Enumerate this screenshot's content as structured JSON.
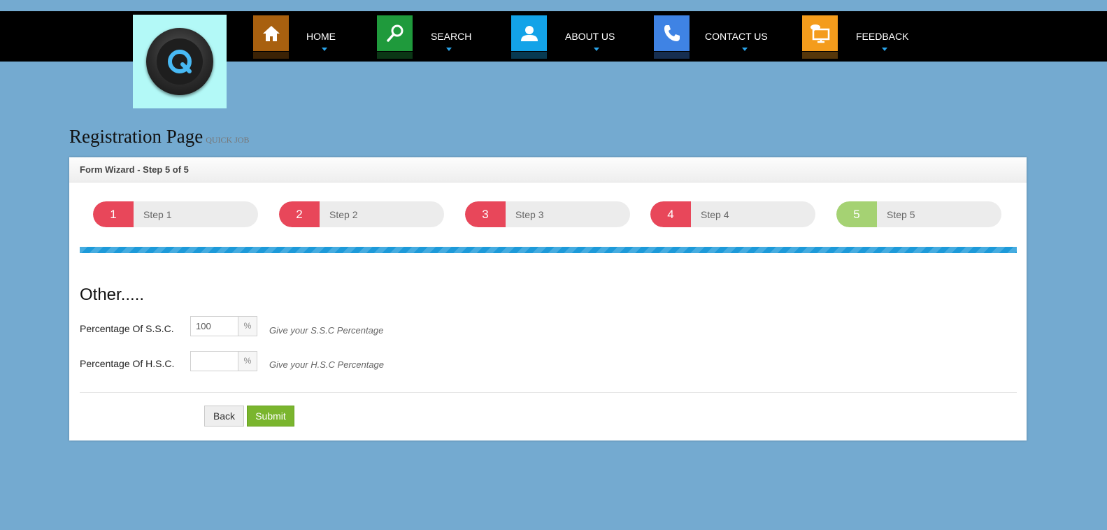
{
  "nav": {
    "items": [
      {
        "label": "HOME",
        "icon": "home-icon",
        "color": "#a8600f"
      },
      {
        "label": "SEARCH",
        "icon": "search-icon",
        "color": "#1f9a3c"
      },
      {
        "label": "ABOUT US",
        "icon": "user-icon",
        "color": "#13a3e8"
      },
      {
        "label": "CONTACT US",
        "icon": "phone-icon",
        "color": "#3f83e4"
      },
      {
        "label": "FEEDBACK",
        "icon": "monitor-chat-icon",
        "color": "#f49c1c"
      }
    ]
  },
  "page": {
    "title": "Registration Page",
    "subtitle": "QUICK JOB"
  },
  "wizard": {
    "header": "Form Wizard - Step 5 of 5",
    "current_step": 5,
    "progress_percent": 100,
    "steps": [
      {
        "number": "1",
        "label": "Step 1",
        "color": "#e8475a"
      },
      {
        "number": "2",
        "label": "Step 2",
        "color": "#e8475a"
      },
      {
        "number": "3",
        "label": "Step 3",
        "color": "#e8475a"
      },
      {
        "number": "4",
        "label": "Step 4",
        "color": "#e8475a"
      },
      {
        "number": "5",
        "label": "Step 5",
        "color": "#a5d273"
      }
    ]
  },
  "form": {
    "section_title": "Other.....",
    "fields": [
      {
        "label": "Percentage Of S.S.C.",
        "value": "100",
        "addon": "%",
        "help": "Give your S.S.C Percentage"
      },
      {
        "label": "Percentage Of H.S.C.",
        "value": "",
        "addon": "%",
        "help": "Give your H.S.C Percentage"
      }
    ],
    "back_label": "Back",
    "submit_label": "Submit"
  },
  "colors": {
    "background": "#74aad0",
    "progress": "#1d9ad9",
    "submit": "#7ab52e",
    "logo_bg": "#b3f9f7"
  }
}
